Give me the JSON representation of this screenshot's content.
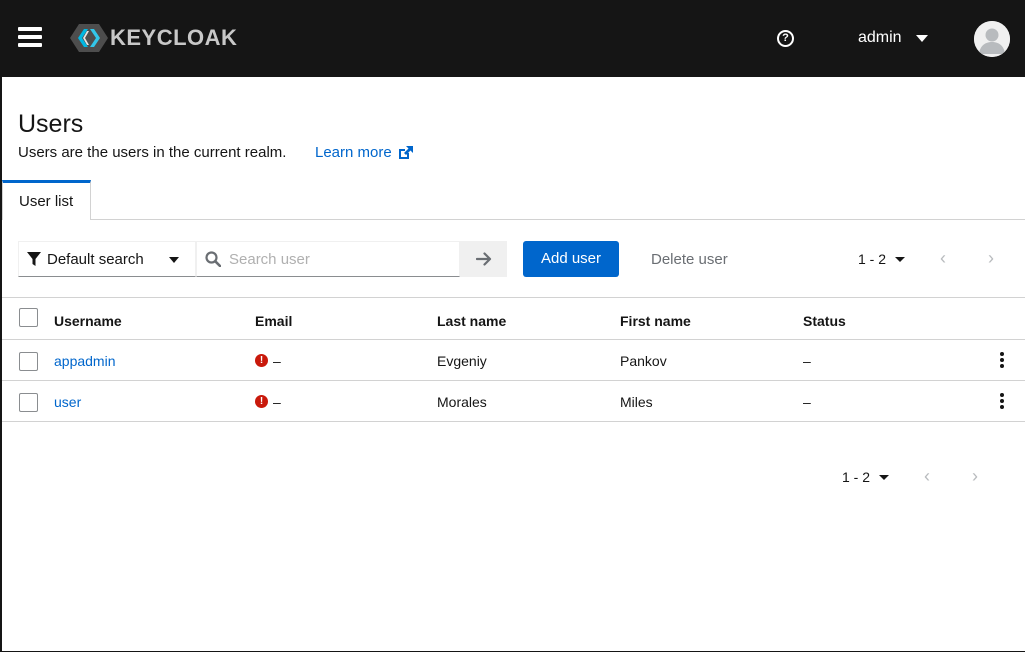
{
  "header": {
    "brand": "KEYCLOAK",
    "username": "admin",
    "help_label": "?"
  },
  "page": {
    "title": "Users",
    "description": "Users are the users in the current realm.",
    "learn_more": "Learn more"
  },
  "tabs": [
    {
      "label": "User list",
      "active": true
    }
  ],
  "toolbar": {
    "search_type": "Default search",
    "search_placeholder": "Search user",
    "add_label": "Add user",
    "delete_label": "Delete user",
    "pagination": "1 - 2"
  },
  "table": {
    "columns": [
      "Username",
      "Email",
      "Last name",
      "First name",
      "Status"
    ],
    "rows": [
      {
        "username": "appadmin",
        "email": "–",
        "last_name": "Evgeniy",
        "first_name": "Pankov",
        "status": "–"
      },
      {
        "username": "user",
        "email": "–",
        "last_name": "Morales",
        "first_name": "Miles",
        "status": "–"
      }
    ]
  },
  "footer": {
    "pagination": "1 - 2"
  },
  "colors": {
    "primary": "#0066cc",
    "masthead": "#151515",
    "danger": "#c9190b"
  }
}
